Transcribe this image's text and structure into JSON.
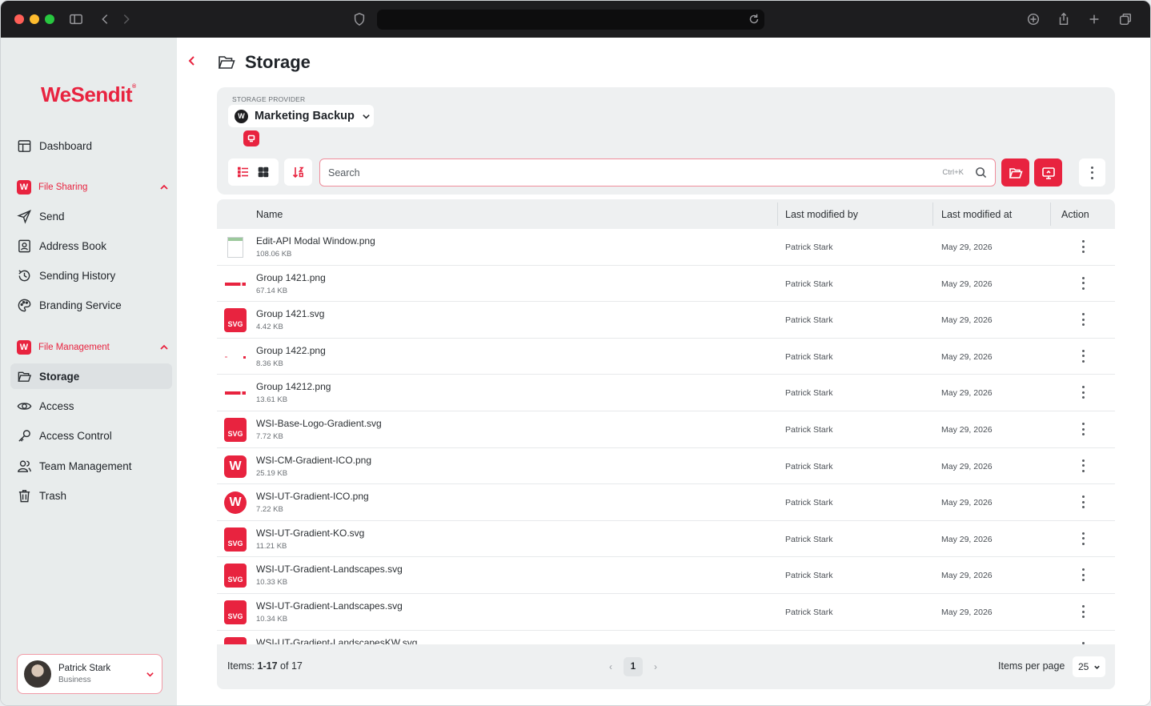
{
  "app": {
    "brand": "WeSendit",
    "brand_mark": "®"
  },
  "sidebar": {
    "top_items": [
      {
        "label": "Dashboard",
        "icon": "dashboard-icon"
      }
    ],
    "sections": [
      {
        "label": "File Sharing",
        "badge": "W",
        "items": [
          {
            "label": "Send",
            "icon": "send-icon"
          },
          {
            "label": "Address Book",
            "icon": "address-book-icon"
          },
          {
            "label": "Sending History",
            "icon": "history-icon"
          },
          {
            "label": "Branding Service",
            "icon": "palette-icon"
          }
        ]
      },
      {
        "label": "File Management",
        "badge": "W",
        "items": [
          {
            "label": "Storage",
            "icon": "folder-open-icon",
            "active": true
          },
          {
            "label": "Access",
            "icon": "eye-icon"
          },
          {
            "label": "Access Control",
            "icon": "key-icon"
          },
          {
            "label": "Team Management",
            "icon": "team-icon"
          },
          {
            "label": "Trash",
            "icon": "trash-icon"
          }
        ]
      }
    ],
    "user": {
      "name": "Patrick Stark",
      "role": "Business"
    }
  },
  "page": {
    "title": "Storage"
  },
  "provider": {
    "label": "STORAGE PROVIDER",
    "selected": "Marketing Backup",
    "logo_letter": "W"
  },
  "toolbar": {
    "search_placeholder": "Search",
    "search_hint": "Ctrl+K"
  },
  "table": {
    "columns": [
      "Name",
      "Last modified by",
      "Last modified at",
      "Action"
    ],
    "rows": [
      {
        "name": "Edit-API Modal Window.png",
        "size": "108.06 KB",
        "by": "Patrick Stark",
        "at": "May 29, 2026",
        "thumb": "doc-thumb"
      },
      {
        "name": "Group 1421.png",
        "size": "67.14 KB",
        "by": "Patrick Stark",
        "at": "May 29, 2026",
        "thumb": "logo-strip"
      },
      {
        "name": "Group 1421.svg",
        "size": "4.42 KB",
        "by": "Patrick Stark",
        "at": "May 29, 2026",
        "thumb": "svg"
      },
      {
        "name": "Group 1422.png",
        "size": "8.36 KB",
        "by": "Patrick Stark",
        "at": "May 29, 2026",
        "thumb": "dot-strip"
      },
      {
        "name": "Group 14212.png",
        "size": "13.61 KB",
        "by": "Patrick Stark",
        "at": "May 29, 2026",
        "thumb": "logo-strip"
      },
      {
        "name": "WSI-Base-Logo-Gradient.svg",
        "size": "7.72 KB",
        "by": "Patrick Stark",
        "at": "May 29, 2026",
        "thumb": "svg"
      },
      {
        "name": "WSI-CM-Gradient-ICO.png",
        "size": "25.19 KB",
        "by": "Patrick Stark",
        "at": "May 29, 2026",
        "thumb": "w-square"
      },
      {
        "name": "WSI-UT-Gradient-ICO.png",
        "size": "7.22 KB",
        "by": "Patrick Stark",
        "at": "May 29, 2026",
        "thumb": "w-circle"
      },
      {
        "name": "WSI-UT-Gradient-KO.svg",
        "size": "11.21 KB",
        "by": "Patrick Stark",
        "at": "May 29, 2026",
        "thumb": "svg"
      },
      {
        "name": "WSI-UT-Gradient-Landscapes.svg",
        "size": "10.33 KB",
        "by": "Patrick Stark",
        "at": "May 29, 2026",
        "thumb": "svg"
      },
      {
        "name": "WSI-UT-Gradient-Landscapes.svg",
        "size": "10.34 KB",
        "by": "Patrick Stark",
        "at": "May 29, 2026",
        "thumb": "svg"
      },
      {
        "name": "WSI-UT-Gradient-LandscapesKW.svg",
        "size": "",
        "by": "",
        "at": "",
        "thumb": "svg"
      }
    ],
    "svg_label": "SVG",
    "w_label": "W"
  },
  "footer": {
    "items_prefix": "Items:",
    "items_range": "1-17",
    "items_suffix": "of 17",
    "page_prev": "‹",
    "page_current": "1",
    "page_next": "›",
    "items_per_page_label": "Items per page",
    "items_per_page_value": "25"
  },
  "colors": {
    "accent": "#e8233f",
    "sidebar_bg": "#e8ecec",
    "panel_bg": "#eef0f1"
  }
}
